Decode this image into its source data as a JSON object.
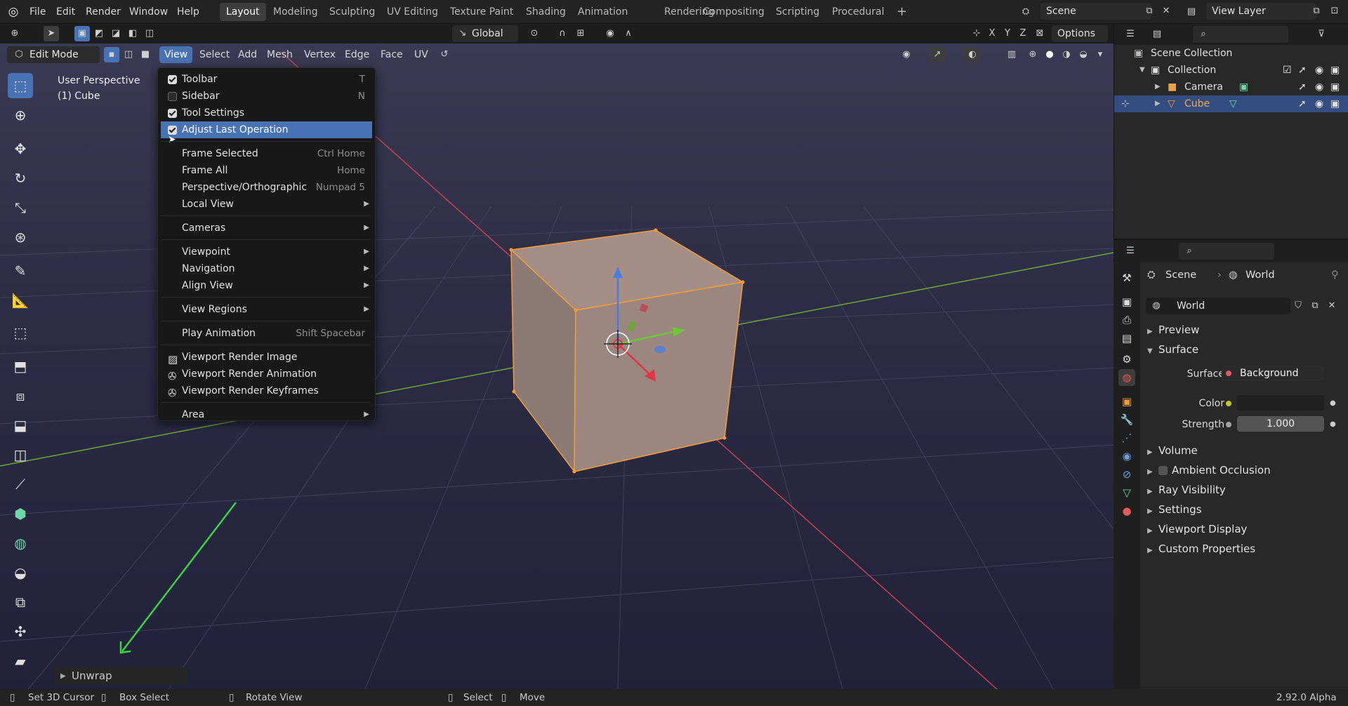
{
  "topbar": {
    "menus": [
      "File",
      "Edit",
      "Render",
      "Window",
      "Help"
    ],
    "workspaces": [
      "Layout",
      "Modeling",
      "Sculpting",
      "UV Editing",
      "Texture Paint",
      "Shading",
      "Animation",
      "Rendering",
      "Compositing",
      "Scripting",
      "Procedural"
    ],
    "active_workspace": "Layout",
    "add_workspace": "+",
    "scene": "Scene",
    "view_layer": "View Layer"
  },
  "toolheader": {
    "orientation": "Global",
    "axes": [
      "X",
      "Y",
      "Z"
    ],
    "options": "Options"
  },
  "vpheader": {
    "mode": "Edit Mode",
    "menus": [
      "View",
      "Select",
      "Add",
      "Mesh",
      "Vertex",
      "Edge",
      "Face",
      "UV"
    ],
    "open_menu": "View"
  },
  "overlay": {
    "line1": "User Perspective",
    "line2": "(1) Cube"
  },
  "view_menu": {
    "items": [
      {
        "label": "Toolbar",
        "shortcut": "T",
        "check": "on"
      },
      {
        "label": "Sidebar",
        "shortcut": "N",
        "check": "off"
      },
      {
        "label": "Tool Settings",
        "shortcut": "",
        "check": "on"
      },
      {
        "label": "Adjust Last Operation",
        "shortcut": "",
        "check": "on",
        "highlight": true
      },
      {
        "label": "Frame Selected",
        "shortcut": "Ctrl Home"
      },
      {
        "label": "Frame All",
        "shortcut": "Home"
      },
      {
        "label": "Perspective/Orthographic",
        "shortcut": "Numpad 5"
      },
      {
        "label": "Local View",
        "submenu": true
      },
      {
        "label": "Cameras",
        "submenu": true
      },
      {
        "label": "Viewpoint",
        "submenu": true
      },
      {
        "label": "Navigation",
        "submenu": true
      },
      {
        "label": "Align View",
        "submenu": true
      },
      {
        "label": "View Regions",
        "submenu": true
      },
      {
        "label": "Play Animation",
        "shortcut": "Shift Spacebar"
      },
      {
        "label": "Viewport Render Image",
        "icon": "image-icon"
      },
      {
        "label": "Viewport Render Animation",
        "icon": "render-animation-icon"
      },
      {
        "label": "Viewport Render Keyframes",
        "icon": "render-keyframes-icon"
      },
      {
        "label": "Area",
        "submenu": true
      }
    ]
  },
  "last_operation": "Unwrap",
  "outliner": {
    "root": "Scene Collection",
    "collection": "Collection",
    "items": [
      "Camera",
      "Cube"
    ],
    "selected": "Cube"
  },
  "properties": {
    "breadcrumb_scene": "Scene",
    "breadcrumb_world": "World",
    "world_name": "World",
    "sections": [
      "Preview",
      "Surface",
      "Volume",
      "Ambient Occlusion",
      "Ray Visibility",
      "Settings",
      "Viewport Display",
      "Custom Properties"
    ],
    "surface_label": "Surface",
    "surface_value": "Background",
    "color_label": "Color",
    "strength_label": "Strength",
    "strength_value": "1.000"
  },
  "statusbar": {
    "items": [
      "Set 3D Cursor",
      "Box Select",
      "Rotate View",
      "Select",
      "Move"
    ],
    "version": "2.92.0 Alpha"
  },
  "colors": {
    "accent": "#4772b3",
    "selected_orange": "#f29d38",
    "axis_x": "#c8404f",
    "axis_y": "#6ca830",
    "axis_z": "#4a7de0"
  }
}
